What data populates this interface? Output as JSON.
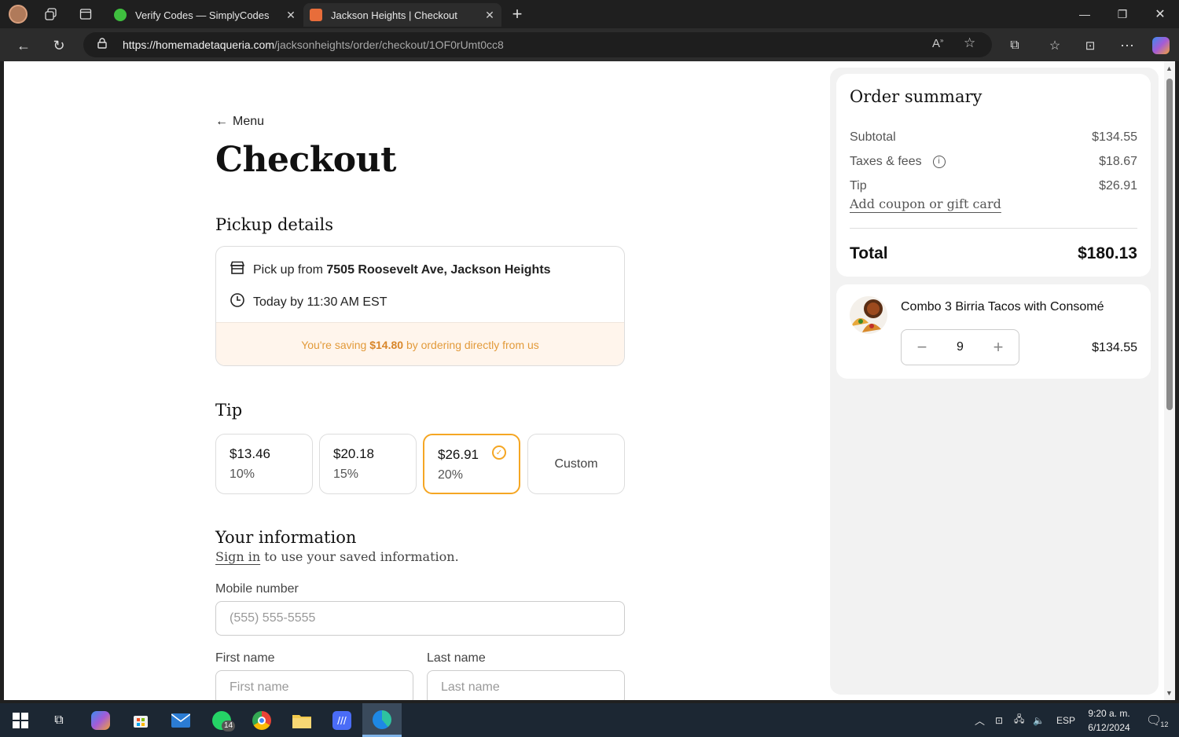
{
  "browser": {
    "tabs": [
      {
        "title": "Verify Codes — SimplyCodes",
        "active": false,
        "favicon_color": "#3fbf3f"
      },
      {
        "title": "Jackson Heights | Checkout",
        "active": true,
        "favicon_color": "#e86d3a"
      }
    ],
    "url_host": "https://homemadetaqueria.com",
    "url_path": "/jacksonheights/order/checkout/1OF0rUmt0cc8"
  },
  "page": {
    "back_label": "Menu",
    "title": "Checkout",
    "pickup": {
      "heading": "Pickup details",
      "location_prefix": "Pick up from",
      "location": "7505 Roosevelt Ave, Jackson Heights",
      "time": "Today by 11:30 AM EST",
      "saving_prefix": "You're saving",
      "saving_amount": "$14.80",
      "saving_suffix": "by ordering directly from us"
    },
    "tip": {
      "heading": "Tip",
      "options": [
        {
          "amount": "$13.46",
          "percent": "10%"
        },
        {
          "amount": "$20.18",
          "percent": "15%"
        },
        {
          "amount": "$26.91",
          "percent": "20%"
        }
      ],
      "selected_index": 2,
      "custom_label": "Custom"
    },
    "info": {
      "heading": "Your information",
      "signin_link": "Sign in",
      "signin_rest": "to use your saved information.",
      "mobile_label": "Mobile number",
      "mobile_placeholder": "(555) 555-5555",
      "first_label": "First name",
      "first_placeholder": "First name",
      "last_label": "Last name",
      "last_placeholder": "Last name"
    }
  },
  "summary": {
    "title": "Order summary",
    "subtotal_label": "Subtotal",
    "subtotal": "$134.55",
    "taxes_label": "Taxes & fees",
    "taxes": "$18.67",
    "tip_label": "Tip",
    "tip": "$26.91",
    "coupon_label": "Add coupon or gift card",
    "total_label": "Total",
    "total": "$180.13",
    "item": {
      "name": "Combo 3 Birria Tacos with Consomé",
      "quantity": "9",
      "price": "$134.55"
    }
  },
  "taskbar": {
    "whatsapp_badge": "14",
    "language": "ESP",
    "time": "9:20 a. m.",
    "date": "6/12/2024",
    "notifications": "12"
  }
}
